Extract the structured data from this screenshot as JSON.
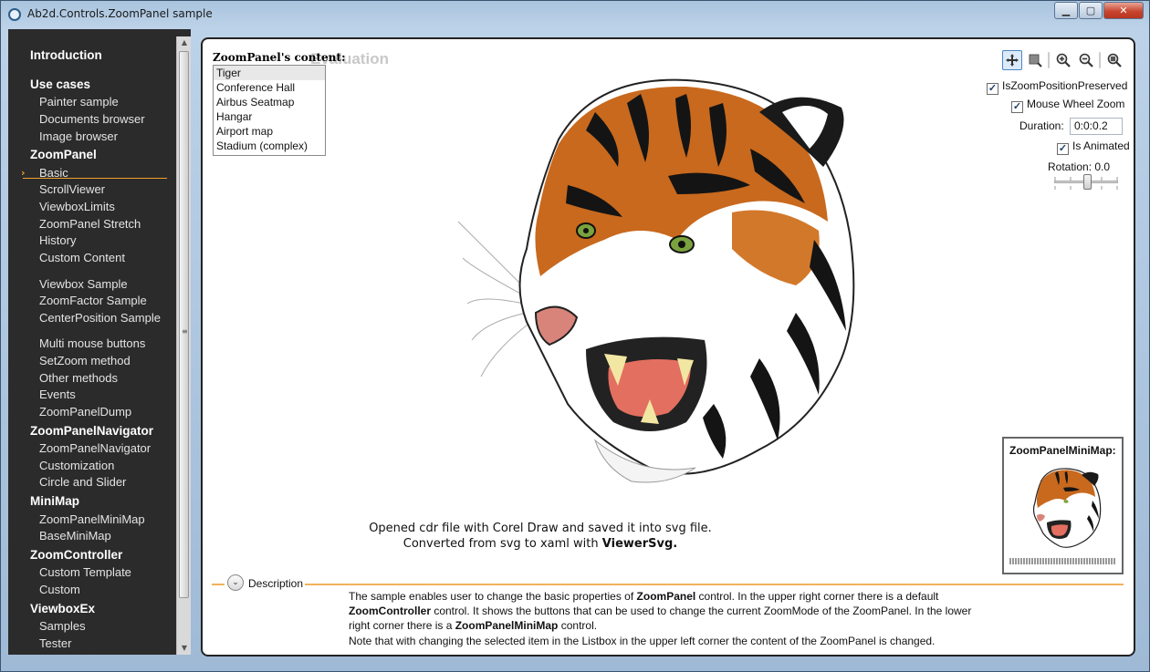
{
  "window": {
    "title": "Ab2d.Controls.ZoomPanel sample",
    "minimize": "▁",
    "maximize": "▢",
    "close": "✕"
  },
  "sidebar": {
    "sections": [
      {
        "heading": "Introduction"
      },
      {
        "heading": "Use cases",
        "items": [
          "Painter sample",
          "Documents browser",
          "Image browser"
        ]
      },
      {
        "heading": "ZoomPanel",
        "items": [
          "Basic",
          "ScrollViewer",
          "ViewboxLimits",
          "ZoomPanel Stretch",
          "History",
          "Custom Content",
          "Viewbox Sample",
          "ZoomFactor Sample",
          "CenterPosition Sample",
          "Multi mouse buttons",
          "SetZoom method",
          "Other methods",
          "Events",
          "ZoomPanelDump"
        ]
      },
      {
        "heading": "ZoomPanelNavigator",
        "items": [
          "ZoomPanelNavigator",
          "Customization",
          "Circle and Slider"
        ]
      },
      {
        "heading": "MiniMap",
        "items": [
          "ZoomPanelMiniMap",
          "BaseMiniMap"
        ]
      },
      {
        "heading": "ZoomController",
        "items": [
          "Custom Template",
          "Custom"
        ]
      },
      {
        "heading": "ViewboxEx",
        "items": [
          "Samples",
          "Tester"
        ]
      }
    ],
    "selected": "Basic"
  },
  "content": {
    "list_label": "ZoomPanel's content:",
    "watermark": "Evaluation",
    "list_items": [
      "Tiger",
      "Conference Hall",
      "Airbus Seatmap",
      "Hangar",
      "Airport map",
      "Stadium (complex)"
    ],
    "selected_item": "Tiger",
    "caption_line1": "Opened cdr file with Corel Draw and saved it into svg file.",
    "caption_line2_prefix": "Converted from svg to xaml with ",
    "caption_line2_bold": "ViewerSvg."
  },
  "zoom_controller": {
    "buttons": [
      "move-icon",
      "rectangle-zoom-icon",
      "zoom-in-icon",
      "zoom-out-icon",
      "reset-zoom-icon"
    ],
    "options": {
      "is_zoom_position_preserved": "IsZoomPositionPreserved",
      "mouse_wheel_zoom": "Mouse Wheel Zoom",
      "duration_label": "Duration:",
      "duration_value": "0:0:0.2",
      "is_animated": "Is Animated",
      "rotation_label": "Rotation:",
      "rotation_value": "0.0"
    }
  },
  "minimap": {
    "title": "ZoomPanelMiniMap:"
  },
  "description": {
    "label": "Description",
    "p1_a": "The sample enables user to change the basic properties of ",
    "p1_b": "ZoomPanel",
    "p1_c": " control. In the upper right corner there is a default",
    "p2_a": "ZoomController",
    "p2_b": " control. It shows the buttons that can be used to change the current ZoomMode of the ZoomPanel. In the lower",
    "p3_a": "right corner there is a ",
    "p3_b": "ZoomPanelMiniMap",
    "p3_c": " control.",
    "p4": "Note that with changing the selected item in the Listbox in the upper left corner the content of the ZoomPanel is changed."
  },
  "colors": {
    "accent": "#f0a030",
    "sidebar_bg": "#2b2b2b"
  }
}
